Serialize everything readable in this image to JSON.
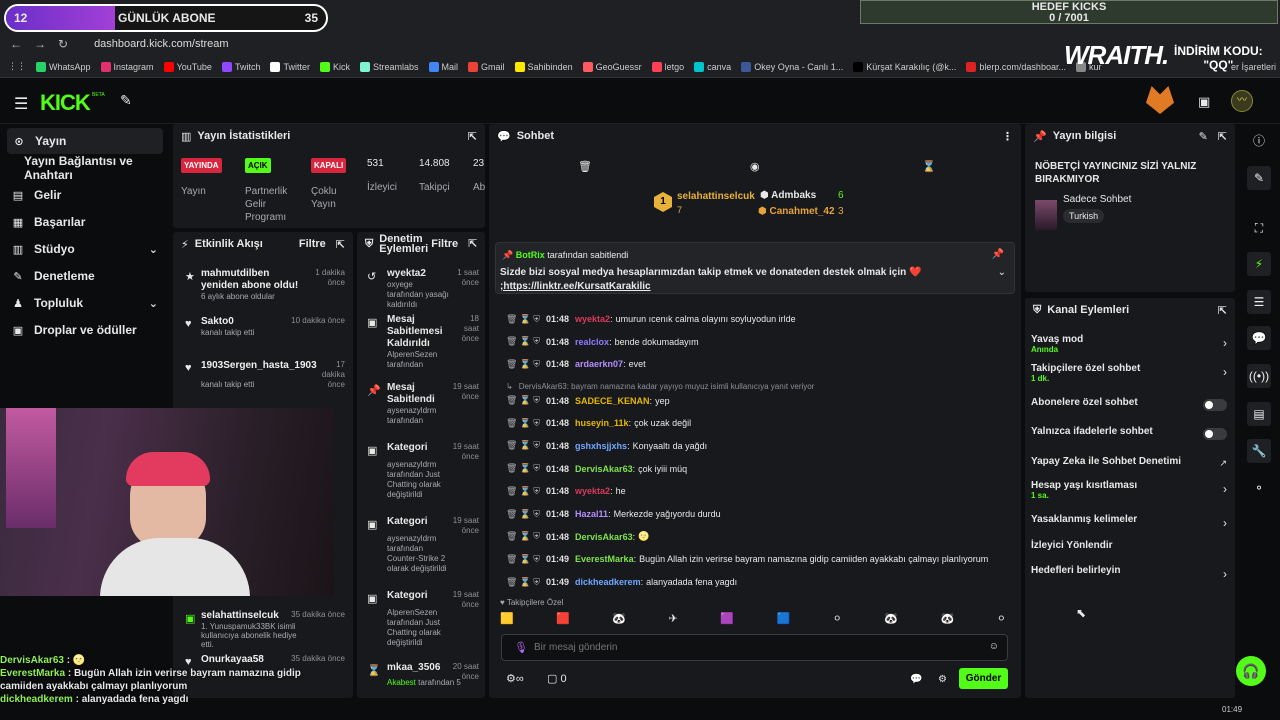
{
  "browser": {
    "url": "dashboard.kick.com/stream",
    "clock": "01:49",
    "bookmarks": [
      {
        "label": "WhatsApp",
        "color": "#25d366"
      },
      {
        "label": "Instagram",
        "color": "#e1306c"
      },
      {
        "label": "YouTube",
        "color": "#ff0000"
      },
      {
        "label": "Twitch",
        "color": "#9146ff"
      },
      {
        "label": "Twitter",
        "color": "#ffffff"
      },
      {
        "label": "Kick",
        "color": "#53fc18"
      },
      {
        "label": "Streamlabs",
        "color": "#80f5d2"
      },
      {
        "label": "Mail",
        "color": "#4285f4"
      },
      {
        "label": "Gmail",
        "color": "#ea4335"
      },
      {
        "label": "Sahibinden",
        "color": "#ffe800"
      },
      {
        "label": "GeoGuessr",
        "color": "#ff5a5f"
      },
      {
        "label": "letgo",
        "color": "#ff3f55"
      },
      {
        "label": "canva",
        "color": "#00c4cc"
      },
      {
        "label": "Okey Oyna - Canlı 1...",
        "color": "#3b5998"
      },
      {
        "label": "Kürşat Karakılıç (@k...",
        "color": "#000000"
      },
      {
        "label": "blerp.com/dashboar...",
        "color": "#d22"
      },
      {
        "label": "kur",
        "color": "#888"
      }
    ],
    "bookmarks_other": "er İşaretleri"
  },
  "overlay": {
    "sub_goal": {
      "current": "12",
      "label": "GÜNLÜK ABONE",
      "target": "35",
      "progress": 0.34
    },
    "kick_goal": {
      "title": "HEDEF KICKS",
      "value": "0 / 7001"
    },
    "wraith": "WRAITH.",
    "promo_line1": "İNDİRİM KODU:",
    "promo_line2": "\"QQ\""
  },
  "kick": {
    "logo": "KICK",
    "beta": "BETA"
  },
  "sidebar": {
    "items": [
      {
        "label": "Yayın",
        "icon": "broadcast-icon"
      },
      {
        "label": "Yayın Bağlantısı ve Anahtarı"
      },
      {
        "label": "Gelir",
        "icon": "revenue-icon"
      },
      {
        "label": "Başarılar",
        "icon": "achievements-icon"
      },
      {
        "label": "Stüdyo",
        "icon": "studio-icon"
      },
      {
        "label": "Denetleme",
        "icon": "moderation-icon"
      },
      {
        "label": "Topluluk",
        "icon": "community-icon"
      },
      {
        "label": "Droplar ve ödüller",
        "icon": "drops-icon"
      }
    ]
  },
  "stats": {
    "title": "Yayın İstatistikleri",
    "items": [
      {
        "badge": "YAYINDA",
        "label": "Yayın",
        "color": "#d7263d"
      },
      {
        "badge": "AÇIK",
        "label": "Partnerlik Gelir Programı",
        "color": "#53fc18"
      },
      {
        "badge": "KAPALI",
        "label": "Çoklu Yayın",
        "color": "#d7263d"
      },
      {
        "value": "531",
        "label": "İzleyici"
      },
      {
        "value": "14.808",
        "label": "Takipçi"
      },
      {
        "value": "23",
        "label": "Ab"
      }
    ]
  },
  "activity": {
    "title": "Etkinlik Akışı",
    "filter": "Filtre",
    "items": [
      {
        "title": "mahmutdilben yeniden abone oldu!",
        "sub": "6 aylık abone oldular",
        "time": "1 dakika önce"
      },
      {
        "title": "Sakto0",
        "sub": "kanalı takip etti",
        "time": "10 dakika önce"
      },
      {
        "title": "1903Sergen_hasta_1903",
        "sub": "kanalı takip etti",
        "time": "17 dakika önce"
      },
      {
        "title": "selahattinselcuk",
        "sub": "1. Yunuspamuk33BK isimli kullanıcıya abonelik hediye etti.",
        "time": "35 dakika önce"
      },
      {
        "title": "Onurkayaa58",
        "sub": "",
        "time": "35 dakika önce"
      }
    ]
  },
  "moderation": {
    "title": "Denetim Eylemleri",
    "filter": "Filtre",
    "items": [
      {
        "title": "wyekta2",
        "sub1": "oxyege",
        "sub2": "tarafından yasağı kaldırıldı",
        "time": "1 saat önce"
      },
      {
        "title": "Mesaj Sabitlemesi Kaldırıldı",
        "sub1": "AlperenSezen",
        "sub2": "tarafından",
        "time": "18 saat önce"
      },
      {
        "title": "Mesaj Sabitlendi",
        "sub1": "aysenazyldrm",
        "sub2": "tarafından",
        "time": "19 saat önce"
      },
      {
        "title": "Kategori",
        "sub1": "aysenazyldrm",
        "sub2": "tarafından Just Chatting olarak değiştirildi",
        "time": "19 saat önce"
      },
      {
        "title": "Kategori",
        "sub1": "aysenazyldrm",
        "sub2": "tarafından Counter-Strike 2 olarak değiştirildi",
        "time": "19 saat önce"
      },
      {
        "title": "Kategori",
        "sub1": "AlperenSezen",
        "sub2": "tarafından Just Chatting olarak değiştirildi",
        "time": "19 saat önce"
      },
      {
        "title": "mkaa_3506",
        "sub1": "Akabest",
        "sub2": "tarafından 5",
        "time": "20 saat önce"
      }
    ]
  },
  "chat": {
    "title": "Sohbet",
    "leaders": [
      {
        "name": "selahattinselcuk",
        "count": "7"
      },
      {
        "name": "Admbaks",
        "count": "6"
      },
      {
        "name": "Canahmet_42",
        "count": "3"
      }
    ],
    "pinned": {
      "by": "BotRix",
      "by_suffix": "tarafından sabitlendi",
      "text": "Sizde bizi sosyal medya hesaplarımızdan takip etmek ve donateden destek olmak için ❤️",
      "link": ";https://linktr.ee/KursatKarakilic"
    },
    "messages": [
      {
        "time": "01:48",
        "user": "wyekta2",
        "color": "#d93a5c",
        "text": "umurun ıcenık calma olayını soyluyodun irlde"
      },
      {
        "time": "01:48",
        "user": "realclox",
        "color": "#8f7bff",
        "text": "bende dokumadayım"
      },
      {
        "time": "01:48",
        "user": "ardaerkn07",
        "color": "#b58dff",
        "text": "evet"
      },
      {
        "reply": "DervisAkar63: bayram namazına kadar yayıyo muyuz isimli kullanıcıya yanıt veriyor"
      },
      {
        "time": "01:48",
        "user": "SADECE_KENAN",
        "color": "#e6b800",
        "text": "yep"
      },
      {
        "time": "01:48",
        "user": "huseyin_11k",
        "color": "#e6b800",
        "text": "çok uzak değil"
      },
      {
        "time": "01:48",
        "user": "gshxhsjjxhs",
        "color": "#6fa8ff",
        "text": "Konyaaltı da yağdı"
      },
      {
        "time": "01:48",
        "user": "DervisAkar63",
        "color": "#7fe34a",
        "text": "çok iyiii müq"
      },
      {
        "time": "01:48",
        "user": "wyekta2",
        "color": "#d93a5c",
        "text": "he"
      },
      {
        "time": "01:48",
        "user": "Hazal11",
        "color": "#b58dff",
        "text": "Merkezde yağıyordu durdu"
      },
      {
        "time": "01:48",
        "user": "DervisAkar63",
        "color": "#7fe34a",
        "text": "🌝"
      },
      {
        "time": "01:49",
        "user": "EverestMarka",
        "color": "#7fe34a",
        "text": "Bugün Allah izin verirse bayram namazına gidip camiiden ayakkabı çalmayı planlıyorum"
      },
      {
        "time": "01:49",
        "user": "dickheadkerem",
        "color": "#6fa8ff",
        "text": "alanyadada fena yagdı"
      }
    ],
    "emote_label": "Takipçilere Özel",
    "placeholder": "Bir mesaj gönderin",
    "send": "Gönder",
    "points": "0"
  },
  "stream_info": {
    "title": "Yayın bilgisi",
    "stream_title": "NÖBETÇİ YAYINCINIZ SİZİ YALNIZ BIRAKMIYOR",
    "category": "Sadece Sohbet",
    "language": "Turkish"
  },
  "channel_actions": {
    "title": "Kanal Eylemleri",
    "items": [
      {
        "label": "Yavaş mod",
        "sub": "Anında",
        "type": "arrow"
      },
      {
        "label": "Takipçilere özel sohbet",
        "sub": "1 dk.",
        "type": "arrow"
      },
      {
        "label": "Abonelere özel sohbet",
        "type": "toggle"
      },
      {
        "label": "Yalnızca ifadelerle sohbet",
        "type": "toggle"
      },
      {
        "label": "Yapay Zeka ile Sohbet Denetimi",
        "type": "link"
      },
      {
        "label": "Hesap yaşı kısıtlaması",
        "sub": "1 sa.",
        "type": "arrow"
      },
      {
        "label": "Yasaklanmış kelimeler",
        "type": "arrow"
      },
      {
        "label": "İzleyici Yönlendir",
        "type": "none"
      },
      {
        "label": "Hedefleri belirleyin",
        "type": "arrow"
      }
    ]
  },
  "overlay_chat": [
    {
      "user": "DervisAkar63",
      "text": "🌝"
    },
    {
      "user": "EverestMarka",
      "text": "Bugün Allah izin verirse bayram namazına gidip camiiden ayakkabı çalmayı planlıyorum"
    },
    {
      "user": "dickheadkerem",
      "text": "alanyadada fena yagdı"
    }
  ]
}
